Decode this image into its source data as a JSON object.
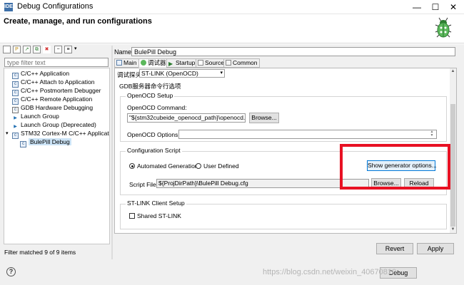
{
  "window": {
    "title": "Debug Configurations",
    "app_icon": "IDE",
    "minimize": "—",
    "maximize": "☐",
    "close": "✕"
  },
  "header": {
    "heading": "Create, manage, and run configurations"
  },
  "left": {
    "filter_placeholder": "type filter text",
    "tree": [
      {
        "label": "C/C++ Application",
        "icon": "c-app-icon"
      },
      {
        "label": "C/C++ Attach to Application",
        "icon": "c-attach-icon"
      },
      {
        "label": "C/C++ Postmortem Debugger",
        "icon": "c-postmortem-icon"
      },
      {
        "label": "C/C++ Remote Application",
        "icon": "c-remote-icon"
      },
      {
        "label": "GDB Hardware Debugging",
        "icon": "gdb-hw-icon"
      },
      {
        "label": "Launch Group",
        "icon": "launch-group-icon"
      },
      {
        "label": "Launch Group (Deprecated)",
        "icon": "launch-group-deprecated-icon"
      },
      {
        "label": "STM32 Cortex-M C/C++ Applicatio",
        "icon": "stm32-icon"
      },
      {
        "label": "BulePill Debug",
        "icon": "debug-config-icon"
      }
    ],
    "status": "Filter matched 9 of 9 items"
  },
  "right": {
    "name_label": "Name:",
    "name_value": "BulePill Debug",
    "tabs": [
      "Main",
      "调试器",
      "Startup",
      "Source",
      "Common"
    ],
    "probe_label": "调试探头",
    "probe_value": "ST-LINK (OpenOCD)",
    "gdb_options": "GDB服务器命令行选项",
    "openocd_setup": "OpenOCD Setup",
    "openocd_command_label": "OpenOCD Command:",
    "openocd_command_value": "\"${stm32cubeide_openocd_path}\\openocd.exe\"",
    "browse1": "Browse...",
    "openocd_options_label": "OpenOCD Options :",
    "openocd_options_value": "",
    "config_script": "Configuration Script",
    "automated_generation": "Automated Generation",
    "user_defined": "User Defined",
    "show_generator": "Show generator options...",
    "script_file_label": "Script File:",
    "script_file_value": "${ProjDirPath}\\BulePill Debug.cfg",
    "browse2": "Browse...",
    "reload": "Reload",
    "stlink_client": "ST-LINK Client Setup",
    "shared_stlink": "Shared ST-LINK"
  },
  "buttons": {
    "revert": "Revert",
    "apply": "Apply",
    "debug": "Debug",
    "help": "?"
  },
  "watermark": "https://blog.csdn.net/weixin_40670810",
  "colors": {
    "highlight": "#e81123",
    "selection": "#cce4f7",
    "focus": "#0078d7"
  }
}
